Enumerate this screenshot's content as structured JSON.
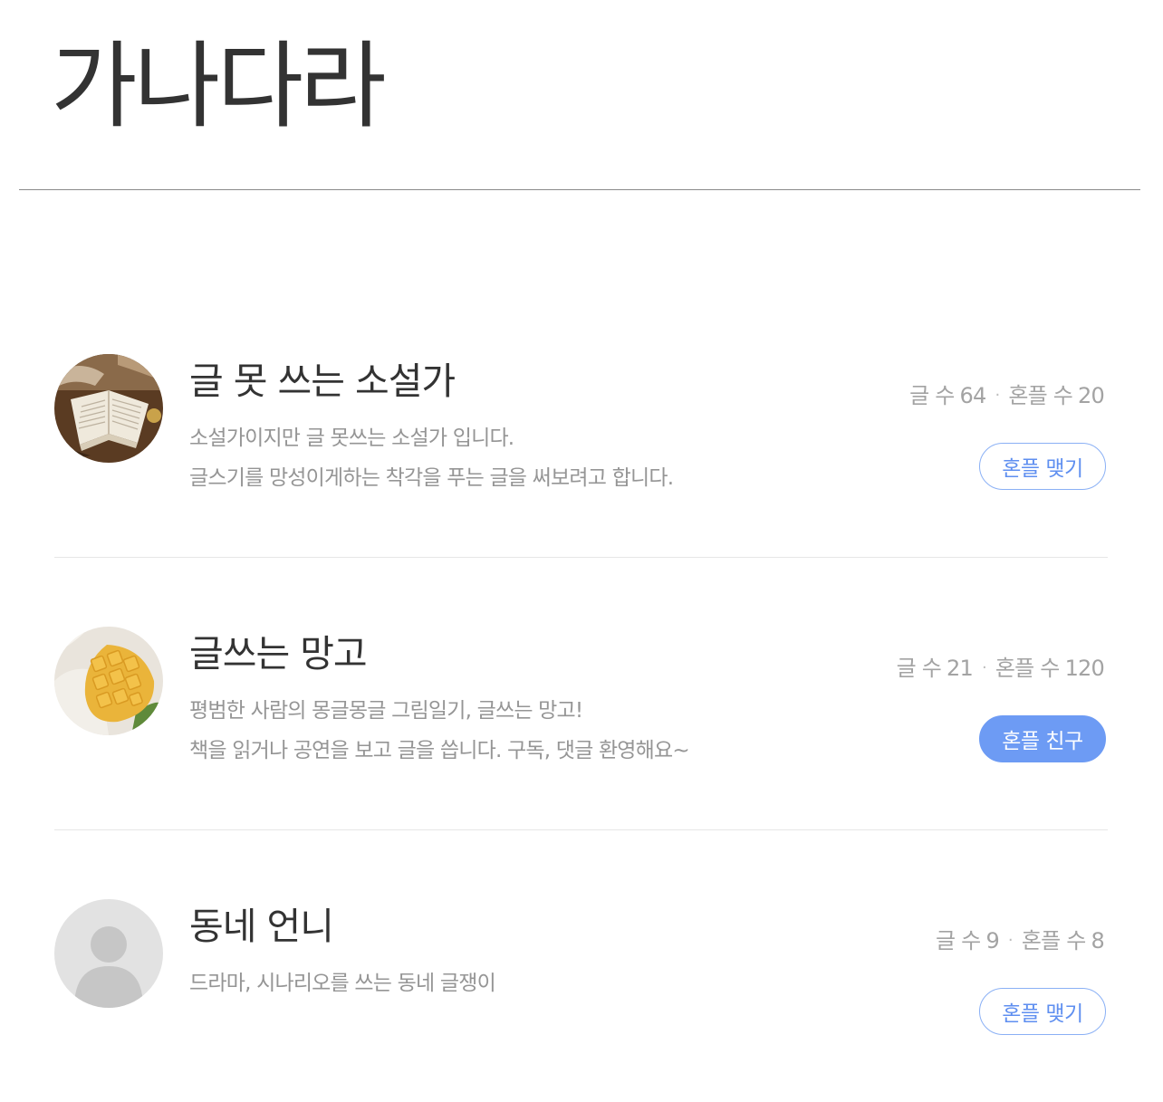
{
  "page": {
    "title": "가나다라"
  },
  "labels": {
    "post_count": "글 수",
    "follower_count": "혼플 수",
    "separator": "·"
  },
  "colors": {
    "accent": "#6d9bf4",
    "text_primary": "#333333",
    "text_secondary": "#959595",
    "stats": "#a3a3a3"
  },
  "writers": [
    {
      "name": "글 못 쓰는 소설가",
      "description": [
        "소설가이지만 글 못쓰는 소설가 입니다.",
        "글스기를 망성이게하는 착각을 푸는 글을 써보려고 합니다."
      ],
      "post_count": "64",
      "follower_count": "20",
      "button_label": "혼플 맺기",
      "button_state": "not-following",
      "avatar_icon": "open-book-photo"
    },
    {
      "name": "글쓰는 망고",
      "description": [
        "평범한 사람의 몽글몽글 그림일기, 글쓰는 망고!",
        "책을 읽거나 공연을 보고 글을 씁니다. 구독, 댓글 환영해요~"
      ],
      "post_count": "21",
      "follower_count": "120",
      "button_label": "혼플 친구",
      "button_state": "following",
      "avatar_icon": "mango-photo"
    },
    {
      "name": "동네 언니",
      "description": [
        "드라마, 시나리오를 쓰는 동네 글쟁이"
      ],
      "post_count": "9",
      "follower_count": "8",
      "button_label": "혼플 맺기",
      "button_state": "not-following",
      "avatar_icon": "default-user-icon"
    }
  ]
}
